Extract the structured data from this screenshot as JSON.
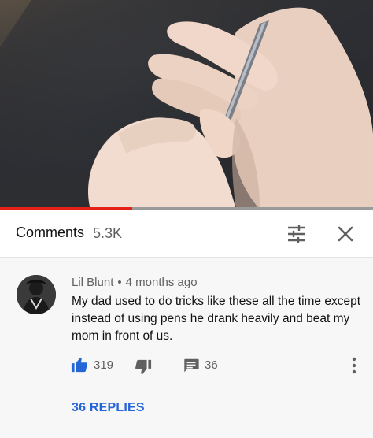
{
  "video": {
    "progress_fraction": 0.355,
    "progress_color": "#e62117"
  },
  "comments_panel": {
    "title": "Comments",
    "count": "5.3K",
    "filter_icon": "sliders-icon",
    "close_icon": "close-icon"
  },
  "comment": {
    "author": "Lil Blunt",
    "separator": "•",
    "time": "4 months ago",
    "text": "My dad used to do tricks like these all the time except instead of using pens he drank heavily and beat my mom in front of us.",
    "likes": "319",
    "replies_count": "36",
    "replies_link": "36 REPLIES",
    "link_color": "#2566d6",
    "like_color": "#2566d6"
  }
}
